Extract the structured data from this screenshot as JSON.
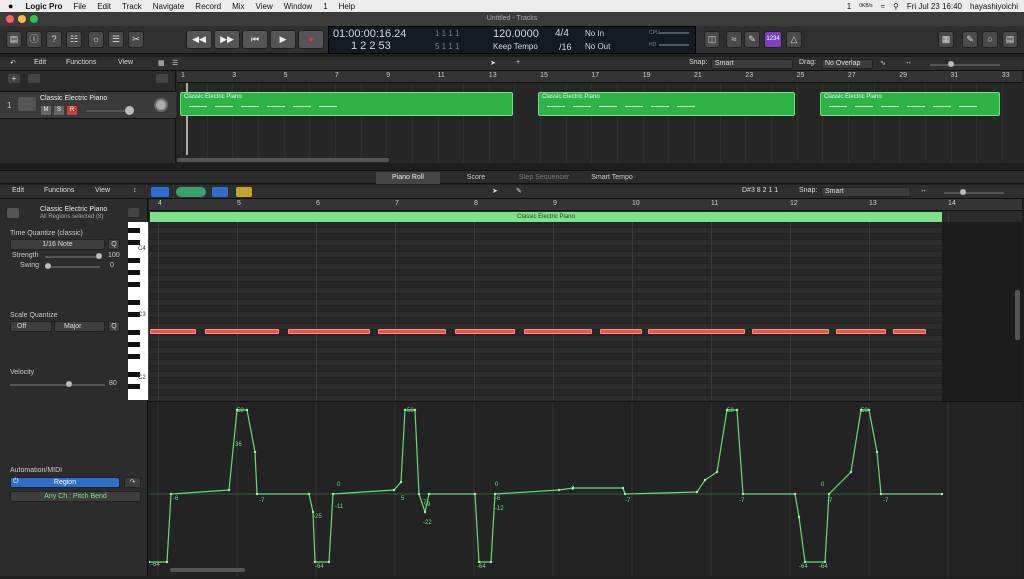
{
  "menubar": {
    "apple": "",
    "app": "Logic Pro",
    "items": [
      "File",
      "Edit",
      "Track",
      "Navigate",
      "Record",
      "Mix",
      "View",
      "Window",
      "1",
      "Help"
    ],
    "right": {
      "notif": "1",
      "net": "0KB/s",
      "user": "hayashiyoichi",
      "datetime": "Fri Jul 23  16:40"
    }
  },
  "window": {
    "title": "Untitled - Tracks"
  },
  "lcd": {
    "time": "01:00:00:16.24",
    "bars": "1  2  2    53",
    "tempo": "120.0000",
    "tempo_mode": "Keep Tempo",
    "sig": "4/4",
    "div": "/16",
    "in": "No In",
    "out": "No Out",
    "counter_a": "1  1  1  1",
    "counter_b": "5  1  1  1",
    "cpu": "CPU",
    "hd": "HD"
  },
  "control": {
    "key_badge": "1234"
  },
  "tracks_toolbar": {
    "edit": "Edit",
    "functions": "Functions",
    "view": "View",
    "snap_label": "Snap:",
    "snap": "Smart",
    "drag_label": "Drag:",
    "drag": "No Overlap"
  },
  "ruler1": [
    "1",
    "3",
    "5",
    "7",
    "9",
    "11",
    "13",
    "15",
    "17",
    "19",
    "21",
    "23",
    "25",
    "27",
    "29",
    "31",
    "33"
  ],
  "track": {
    "number": "1",
    "name": "Classic Electric Piano",
    "m": "M",
    "s": "S",
    "r": "R"
  },
  "regions1": [
    {
      "name": "Classic Electric Piano"
    },
    {
      "name": "Classic Electric Piano"
    },
    {
      "name": "Classic Electric Piano"
    }
  ],
  "tabs": {
    "piano_roll": "Piano Roll",
    "score": "Score",
    "step": "Step Sequencer",
    "smart_tempo": "Smart Tempo"
  },
  "pr_toolbar": {
    "edit": "Edit",
    "functions": "Functions",
    "view": "View",
    "pos": "D#3   8 2 1 1",
    "snap_label": "Snap:",
    "snap": "Smart"
  },
  "inspector": {
    "region_name": "Classic Electric Piano",
    "region_sub": "All Regions selected (8)",
    "tq_label": "Time Quantize (classic)",
    "tq_value": "1/16 Note",
    "q": "Q",
    "strength_label": "Strength",
    "strength": "100",
    "swing_label": "Swing",
    "swing": "0",
    "sq_label": "Scale Quantize",
    "sq_off": "Off",
    "sq_scale": "Major",
    "vel_label": "Velocity",
    "vel": "80",
    "auto_label": "Automation/MIDI",
    "region_btn": "Region",
    "channel": "Any Ch.: Pitch Bend"
  },
  "keyboard_labels": [
    "C4",
    "C3",
    "C2"
  ],
  "pr_ruler": [
    "4",
    "5",
    "6",
    "7",
    "8",
    "9",
    "10",
    "11",
    "12",
    "13",
    "14"
  ],
  "pr_region": "Classic Electric Piano",
  "automation_labels": [
    "-64",
    "-6",
    "58",
    "36",
    "-7",
    "-25",
    "-64",
    "0",
    "-11",
    "58",
    "-7",
    "5",
    "-9",
    "-22",
    "0",
    "-6",
    "-12",
    "-64",
    "3",
    "-7",
    "58",
    "-7",
    "0",
    "-7",
    "-64",
    "58",
    "-64",
    "-7"
  ]
}
